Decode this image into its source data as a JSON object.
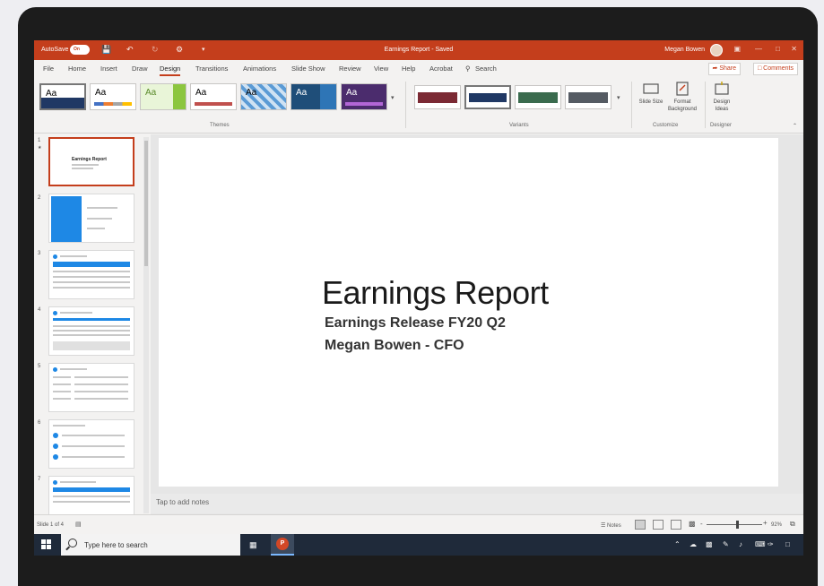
{
  "window": {
    "autosave_label": "AutoSave",
    "autosave_state": "On",
    "document_title": "Earnings Report - Saved",
    "user_name": "Megan Bowen"
  },
  "menu": {
    "tabs": [
      "File",
      "Home",
      "Insert",
      "Draw",
      "Design",
      "Transitions",
      "Animations",
      "Slide Show",
      "Review",
      "View",
      "Help",
      "Acrobat"
    ],
    "active_tab": "Design",
    "search_label": "Search",
    "share_label": "Share",
    "comments_label": "Comments"
  },
  "ribbon": {
    "themes_label": "Themes",
    "variants_label": "Variants",
    "customize_label": "Customize",
    "designer_label": "Designer",
    "theme_text": "Aa",
    "slide_size_label": "Slide Size",
    "format_background_label": "Format Background",
    "design_ideas_label": "Design Ideas"
  },
  "slides": {
    "numbers": [
      "1",
      "2",
      "3",
      "4",
      "5",
      "6",
      "7"
    ],
    "thumb1_title": "Earnings Report"
  },
  "slide": {
    "title": "Earnings Report",
    "subtitle1": "Earnings Release FY20 Q2",
    "subtitle2": "Megan Bowen - CFO"
  },
  "notes": {
    "placeholder": "Tap to add notes"
  },
  "status": {
    "slide_count": "Slide 1 of 4",
    "notes_label": "Notes",
    "zoom": "92%",
    "zoom_level": 0.55
  },
  "taskbar": {
    "search_placeholder": "Type here to search"
  },
  "colors": {
    "accent": "#c43e1c",
    "taskbar": "#1f2a3a"
  }
}
